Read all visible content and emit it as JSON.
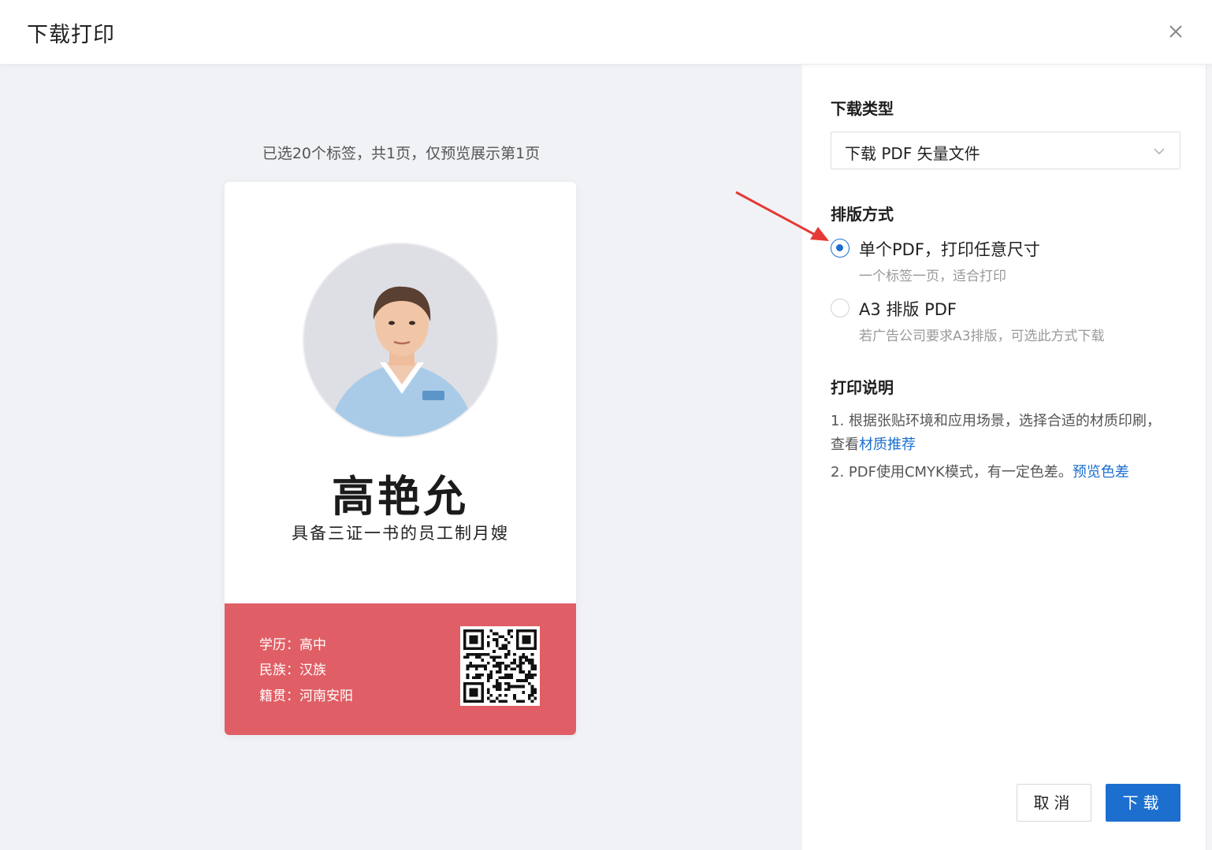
{
  "dialog": {
    "title": "下载打印"
  },
  "preview": {
    "caption": "已选20个标签，共1页，仅预览展示第1页",
    "card": {
      "name": "高艳允",
      "subtitle": "具备三证一书的员工制月嫂",
      "fields": [
        "学历：高中",
        "民族：汉族",
        "籍贯：河南安阳"
      ],
      "accent_color": "#e05e65"
    }
  },
  "settings": {
    "download_type": {
      "title": "下载类型",
      "selected": "下载 PDF 矢量文件"
    },
    "layout": {
      "title": "排版方式",
      "options": [
        {
          "label": "单个PDF，打印任意尺寸",
          "desc": "一个标签一页，适合打印",
          "checked": true
        },
        {
          "label": "A3 排版 PDF",
          "desc": "若广告公司要求A3排版，可选此方式下载",
          "checked": false
        }
      ]
    },
    "notes": {
      "title": "打印说明",
      "items": [
        {
          "text": "1. 根据张贴环境和应用场景，选择合适的材质印刷，查看",
          "link": "材质推荐"
        },
        {
          "text": "2. PDF使用CMYK模式，有一定色差。",
          "link": "预览色差"
        }
      ]
    }
  },
  "footer": {
    "cancel_label": "取消",
    "download_label": "下载"
  },
  "colors": {
    "primary": "#1c6fcf",
    "annotation_arrow": "#e53935"
  }
}
